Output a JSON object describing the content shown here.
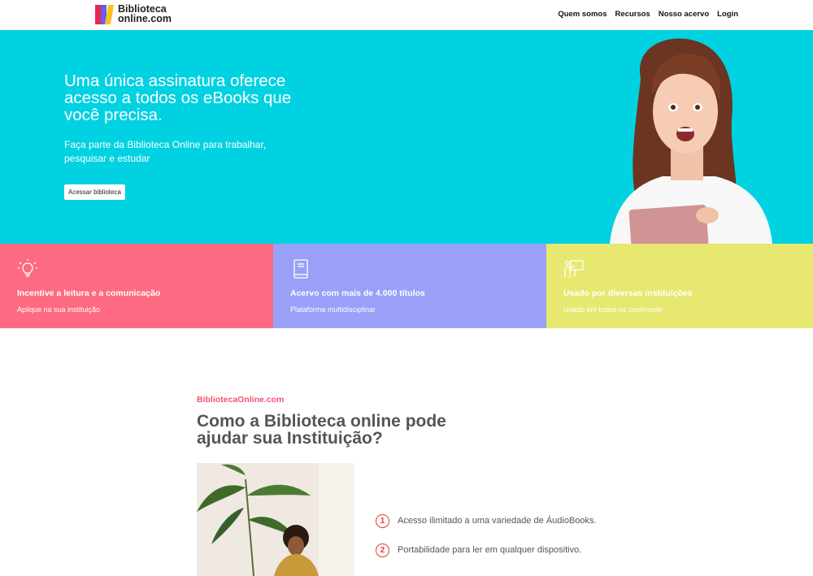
{
  "header": {
    "logo_line1": "Biblioteca",
    "logo_line2": "online.com",
    "nav": [
      "Quem somos",
      "Recursos",
      "Nosso acervo",
      "Login"
    ]
  },
  "hero": {
    "title": "Uma única assinatura oferece acesso a todos os eBooks que você precisa.",
    "subtitle": "Faça parte da Biblioteca Online para trabalhar, pesquisar e estudar",
    "button": "Acessar biblioteca",
    "background": "#00d2e2"
  },
  "features": [
    {
      "icon": "lightbulb-icon",
      "title": "Incentive a leitura e a comunicação",
      "subtitle": "Aplique na sua instituição",
      "color": "#fe6a82"
    },
    {
      "icon": "book-icon",
      "title": "Acervo com mais de 4.000 títulos",
      "subtitle": "Plataforma multidisciplinar",
      "color": "#9aa0f7"
    },
    {
      "icon": "presentation-icon",
      "title": "Usado por diversas instituições",
      "subtitle": "Usado em todos os continente",
      "color": "#e6e870"
    }
  ],
  "section": {
    "kicker": "BibliotecaOnline.com",
    "title": "Como a Biblioteca online pode ajudar sua Instituição?",
    "items": [
      {
        "num": "1",
        "text": "Acesso ilimitado a uma variedade de ÁudioBooks."
      },
      {
        "num": "2",
        "text": "Portabilidade para ler em qualquer dispositivo."
      }
    ]
  }
}
